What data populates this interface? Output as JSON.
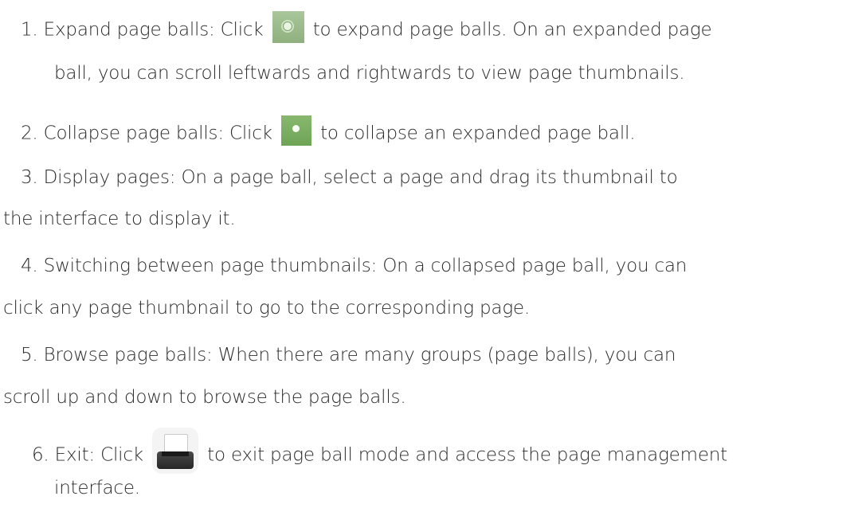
{
  "steps": {
    "s1": {
      "number": "1.",
      "text_before_icon": "Expand page balls: Click",
      "text_after_icon": "to expand page balls. On an expanded page",
      "continuation": "ball, you can scroll leftwards and rightwards to view page thumbnails.",
      "icon": "expand-page-ball-icon"
    },
    "s2": {
      "number": "2.",
      "text_before_icon": "Collapse page balls: Click",
      "text_after_icon": "to collapse an expanded page ball.",
      "icon": "collapse-page-ball-icon"
    },
    "s3": {
      "number": "3.",
      "text": "Display pages: On a page ball, select a page and drag its thumbnail to",
      "continuation": "the interface to display it."
    },
    "s4": {
      "number": "4.",
      "text": "Switching between page thumbnails: On a collapsed page ball, you can",
      "continuation": "click any page thumbnail to go to the corresponding page."
    },
    "s5": {
      "number": "5.",
      "text": "Browse page balls: When there are many groups (page balls), you can",
      "continuation": "scroll up and down to browse the page balls."
    },
    "s6": {
      "number": "6.",
      "text_before_icon": "Exit: Click",
      "text_after_icon": "to exit page ball mode and access the page management",
      "continuation": "interface.",
      "icon": "page-management-icon"
    }
  }
}
